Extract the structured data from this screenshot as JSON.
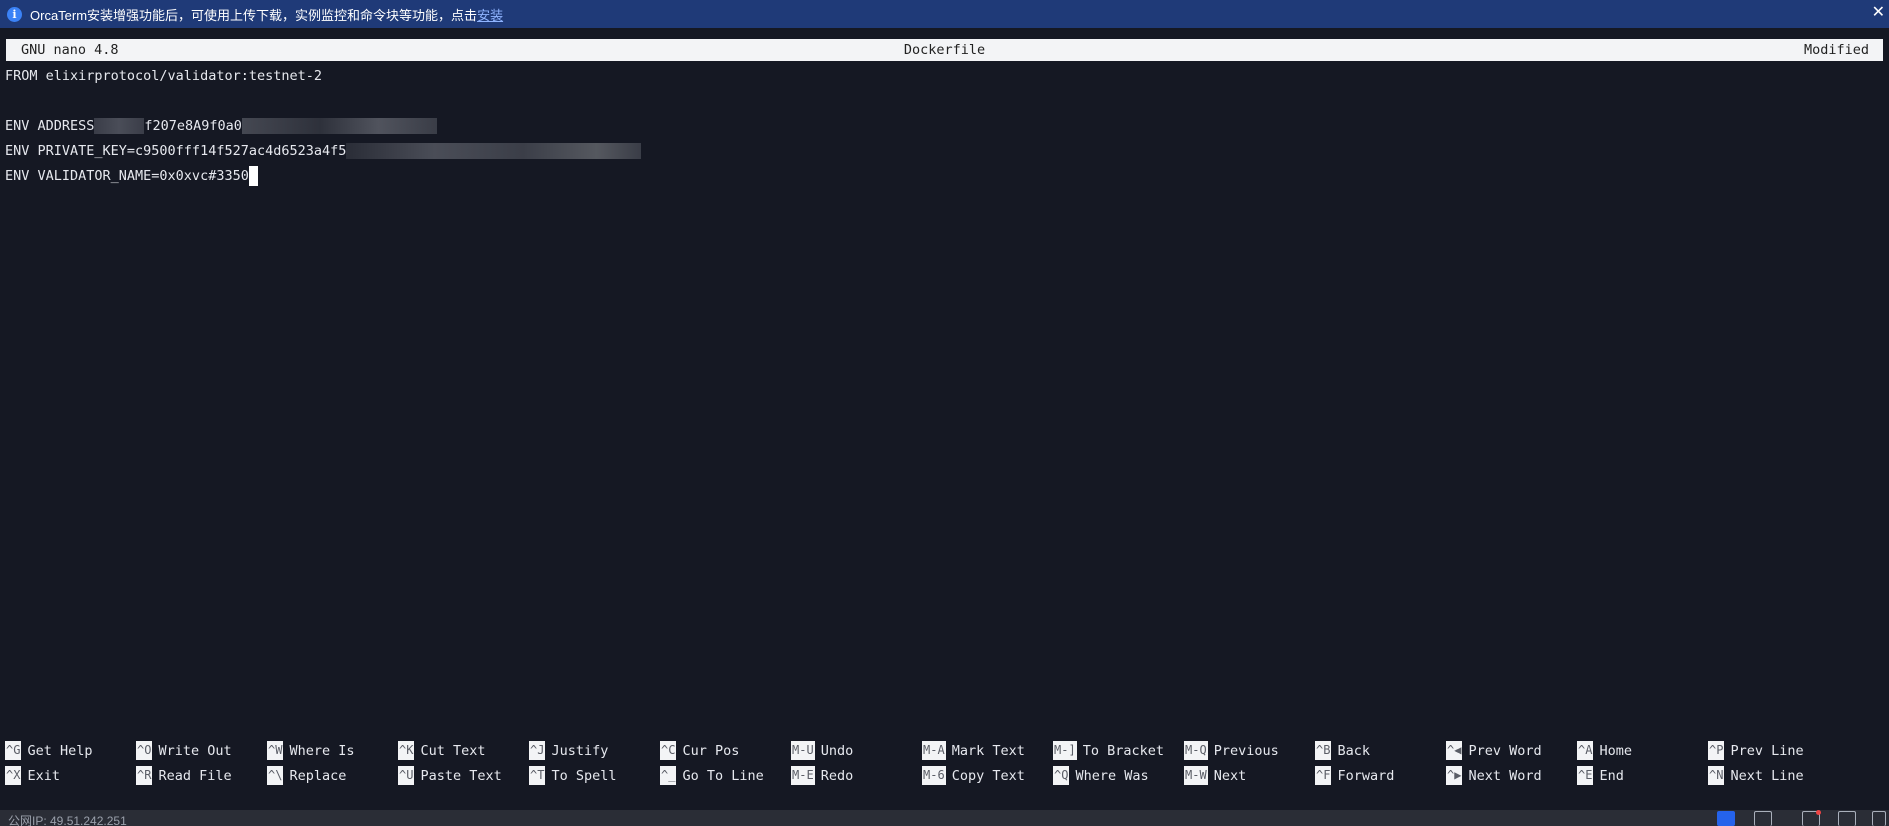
{
  "banner": {
    "message": "OrcaTerm安装增强功能后，可使用上传下载，实例监控和命令块等功能，点击",
    "link": "安装",
    "close": "✕"
  },
  "titlebar": {
    "app": "GNU nano 4.8",
    "filename": "Dockerfile",
    "state": "Modified"
  },
  "editor": {
    "lines": [
      "FROM elixirprotocol/validator:testnet-2",
      "",
      "ENV ADDRESS",
      "ENV PRIVATE_KEY=c9500fff14f527ac4d6523a4f5",
      "ENV VALIDATOR_NAME=0x0xvc#3350"
    ],
    "address_visible": "f207e8A9f0a0"
  },
  "shortcuts": {
    "row1": [
      {
        "key": "^G",
        "label": "Get Help"
      },
      {
        "key": "^O",
        "label": "Write Out"
      },
      {
        "key": "^W",
        "label": "Where Is"
      },
      {
        "key": "^K",
        "label": "Cut Text"
      },
      {
        "key": "^J",
        "label": "Justify"
      },
      {
        "key": "^C",
        "label": "Cur Pos"
      },
      {
        "key": "M-U",
        "label": "Undo"
      },
      {
        "key": "M-A",
        "label": "Mark Text"
      },
      {
        "key": "M-]",
        "label": "To Bracket"
      },
      {
        "key": "M-Q",
        "label": "Previous"
      },
      {
        "key": "^B",
        "label": "Back"
      },
      {
        "key": "^◀",
        "label": "Prev Word"
      },
      {
        "key": "^A",
        "label": "Home"
      },
      {
        "key": "^P",
        "label": "Prev Line"
      }
    ],
    "row2": [
      {
        "key": "^X",
        "label": "Exit"
      },
      {
        "key": "^R",
        "label": "Read File"
      },
      {
        "key": "^\\",
        "label": "Replace"
      },
      {
        "key": "^U",
        "label": "Paste Text"
      },
      {
        "key": "^T",
        "label": "To Spell"
      },
      {
        "key": "^_",
        "label": "Go To Line"
      },
      {
        "key": "M-E",
        "label": "Redo"
      },
      {
        "key": "M-6",
        "label": "Copy Text"
      },
      {
        "key": "^Q",
        "label": "Where Was"
      },
      {
        "key": "M-W",
        "label": "Next"
      },
      {
        "key": "^F",
        "label": "Forward"
      },
      {
        "key": "^▶",
        "label": "Next Word"
      },
      {
        "key": "^E",
        "label": "End"
      },
      {
        "key": "^N",
        "label": "Next Line"
      }
    ]
  },
  "status": {
    "ip": "公网IP: 49.51.242.251"
  },
  "colors": {
    "background": "#151823",
    "banner": "#1f3a78",
    "titlebar": "#f3f4f6"
  }
}
